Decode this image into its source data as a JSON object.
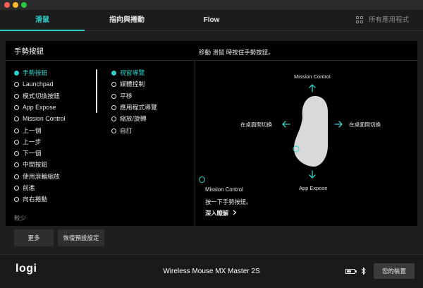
{
  "tabs": [
    {
      "label": "滑鼠"
    },
    {
      "label": "指向與捲動"
    },
    {
      "label": "Flow"
    }
  ],
  "all_apps_label": "所有應用程式",
  "panel": {
    "title": "手勢按鈕",
    "hint": "移動 滑鼠 時按住手勢按鈕。"
  },
  "buttons_list": [
    {
      "label": "手勢按鈕",
      "selected": true
    },
    {
      "label": "Launchpad"
    },
    {
      "label": "模式切換按鈕"
    },
    {
      "label": "App Expose"
    },
    {
      "label": "Mission Control"
    },
    {
      "label": "上一個"
    },
    {
      "label": "上一步"
    },
    {
      "label": "下一個"
    },
    {
      "label": "中間按鈕"
    },
    {
      "label": "使用滾輪縮放"
    },
    {
      "label": "前進"
    },
    {
      "label": "向右捲動"
    }
  ],
  "less_label": "較少",
  "actions_list": [
    {
      "label": "視窗導覽",
      "selected": true
    },
    {
      "label": "媒體控制"
    },
    {
      "label": "平移"
    },
    {
      "label": "應用程式導覽"
    },
    {
      "label": "縮放/旋轉"
    },
    {
      "label": "自訂"
    }
  ],
  "diagram": {
    "up": "Mission Control",
    "left": "在桌面間切換",
    "right": "在桌面間切換",
    "down": "App Expose"
  },
  "description": {
    "title": "Mission Control",
    "text": "按一下手勢按鈕。",
    "learn_more": "深入瞭解"
  },
  "more_button": "更多",
  "reset_button": "恢復預設設定",
  "footer": {
    "logo": "logi",
    "device_name": "Wireless Mouse MX Master 2S",
    "battery_level": 0.6,
    "my_devices": "您的裝置"
  },
  "colors": {
    "accent": "#2fd0c8",
    "background": "#1e1e1e",
    "panel": "#000000"
  }
}
